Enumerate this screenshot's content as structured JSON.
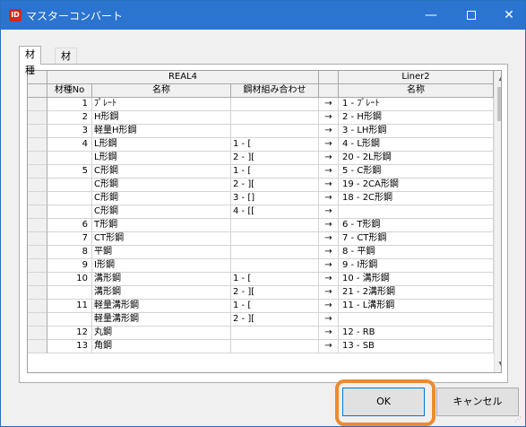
{
  "window": {
    "title": "マスターコンバート",
    "app_icon": "ID",
    "minimize": "—",
    "close": "✕"
  },
  "tabs": [
    {
      "label": "材種",
      "active": true
    },
    {
      "label": "材質",
      "active": false
    }
  ],
  "grid": {
    "group_headers": {
      "left": "REAL4",
      "right": "Liner2"
    },
    "columns": {
      "no": "材種No",
      "name": "名称",
      "combo": "鋼材組み合わせ",
      "liner_name": "名称"
    },
    "rows": [
      {
        "no": "1",
        "name": "ﾌﾟﾚｰﾄ",
        "combo": "",
        "arrow": "→",
        "liner": "1 - ﾌﾟﾚｰﾄ"
      },
      {
        "no": "2",
        "name": "H形鋼",
        "combo": "",
        "arrow": "→",
        "liner": "2 - H形鋼"
      },
      {
        "no": "3",
        "name": "軽量H形鋼",
        "combo": "",
        "arrow": "→",
        "liner": "3 - LH形鋼"
      },
      {
        "no": "4",
        "name": "L形鋼",
        "combo": "1 - [",
        "arrow": "→",
        "liner": "4 - L形鋼"
      },
      {
        "no": "",
        "name": "L形鋼",
        "combo": "2 - ][",
        "arrow": "→",
        "liner": "20 - 2L形鋼"
      },
      {
        "no": "5",
        "name": "C形鋼",
        "combo": "1 - [",
        "arrow": "→",
        "liner": "5 - C形鋼"
      },
      {
        "no": "",
        "name": "C形鋼",
        "combo": "2 - ][",
        "arrow": "→",
        "liner": "19 - 2CA形鋼"
      },
      {
        "no": "",
        "name": "C形鋼",
        "combo": "3 - []",
        "arrow": "→",
        "liner": "18 - 2C形鋼"
      },
      {
        "no": "",
        "name": "C形鋼",
        "combo": "4 - [[",
        "arrow": "→",
        "liner": ""
      },
      {
        "no": "6",
        "name": "T形鋼",
        "combo": "",
        "arrow": "→",
        "liner": "6 - T形鋼"
      },
      {
        "no": "7",
        "name": "CT形鋼",
        "combo": "",
        "arrow": "→",
        "liner": "7 - CT形鋼"
      },
      {
        "no": "8",
        "name": "平鋼",
        "combo": "",
        "arrow": "→",
        "liner": "8 - 平鋼"
      },
      {
        "no": "9",
        "name": "I形鋼",
        "combo": "",
        "arrow": "→",
        "liner": "9 - I形鋼"
      },
      {
        "no": "10",
        "name": "溝形鋼",
        "combo": "1 - [",
        "arrow": "→",
        "liner": "10 - 溝形鋼"
      },
      {
        "no": "",
        "name": "溝形鋼",
        "combo": "2 - ][",
        "arrow": "→",
        "liner": "21 - 2溝形鋼"
      },
      {
        "no": "11",
        "name": "軽量溝形鋼",
        "combo": "1 - [",
        "arrow": "→",
        "liner": "11 - L溝形鋼"
      },
      {
        "no": "",
        "name": "軽量溝形鋼",
        "combo": "2 - ][",
        "arrow": "→",
        "liner": ""
      },
      {
        "no": "12",
        "name": "丸鋼",
        "combo": "",
        "arrow": "→",
        "liner": "12 - RB"
      },
      {
        "no": "13",
        "name": "角鋼",
        "combo": "",
        "arrow": "→",
        "liner": "13 - SB"
      }
    ]
  },
  "buttons": {
    "ok": "OK",
    "cancel": "キャンセル"
  },
  "colors": {
    "titlebar": "#2b74d0",
    "highlight": "#ee8a2e"
  }
}
